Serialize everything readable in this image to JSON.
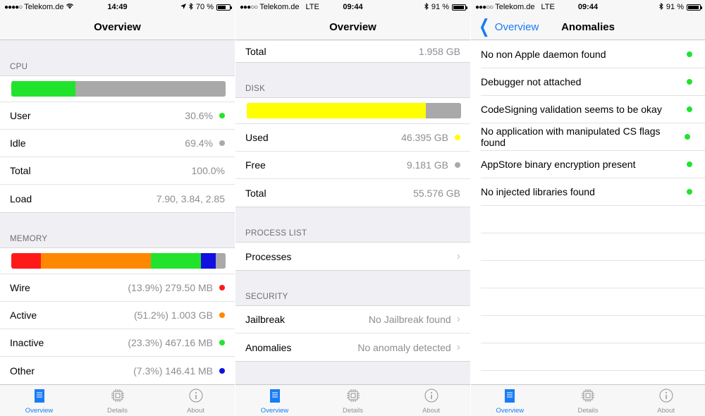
{
  "colors": {
    "green": "#22e32c",
    "gray": "#a9a9a9",
    "red": "#ff1a1a",
    "orange": "#ff8800",
    "blue": "#1010e0",
    "yellow": "#ffff00",
    "accent": "#1a7cf5"
  },
  "screen1": {
    "status": {
      "carrier": "Telekom.de",
      "time": "14:49",
      "battery_pct": "70 %",
      "battery_level": 0.7
    },
    "title": "Overview",
    "cpu": {
      "header": "CPU",
      "bar": [
        0.3,
        0.7
      ],
      "rows": [
        {
          "label": "User",
          "value": "30.6%",
          "dot": "#22e32c"
        },
        {
          "label": "Idle",
          "value": "69.4%",
          "dot": "#a9a9a9"
        },
        {
          "label": "Total",
          "value": "100.0%"
        },
        {
          "label": "Load",
          "value": "7.90, 3.84, 2.85"
        }
      ]
    },
    "memory": {
      "header": "MEMORY",
      "bar": [
        0.139,
        0.512,
        0.233,
        0.07,
        0.046
      ],
      "rows": [
        {
          "label": "Wire",
          "value": "(13.9%) 279.50 MB",
          "dot": "#ff1a1a"
        },
        {
          "label": "Active",
          "value": "(51.2%) 1.003 GB",
          "dot": "#ff8800"
        },
        {
          "label": "Inactive",
          "value": "(23.3%) 467.16 MB",
          "dot": "#22e32c"
        },
        {
          "label": "Other",
          "value": "(7.3%) 146.41 MB",
          "dot": "#1010e0"
        }
      ]
    }
  },
  "screen2": {
    "status": {
      "carrier": "Telekom.de",
      "network": "LTE",
      "time": "09:44",
      "battery_pct": "91 %",
      "battery_level": 0.91
    },
    "title": "Overview",
    "memory_total": {
      "label": "Total",
      "value": "1.958 GB"
    },
    "disk": {
      "header": "DISK",
      "bar": [
        0.835,
        0.165
      ],
      "rows": [
        {
          "label": "Used",
          "value": "46.395 GB",
          "dot": "#ffff00"
        },
        {
          "label": "Free",
          "value": "9.181 GB",
          "dot": "#a9a9a9"
        },
        {
          "label": "Total",
          "value": "55.576 GB"
        }
      ]
    },
    "process": {
      "header": "PROCESS LIST",
      "row": {
        "label": "Processes"
      }
    },
    "security": {
      "header": "SECURITY",
      "rows": [
        {
          "label": "Jailbreak",
          "value": "No Jailbreak found"
        },
        {
          "label": "Anomalies",
          "value": "No anomaly detected"
        }
      ]
    }
  },
  "screen3": {
    "status": {
      "carrier": "Telekom.de",
      "network": "LTE",
      "time": "09:44",
      "battery_pct": "91 %",
      "battery_level": 0.91
    },
    "back_label": "Overview",
    "title": "Anomalies",
    "items": [
      "No non Apple daemon found",
      "Debugger not attached",
      "CodeSigning validation seems to be okay",
      "No application with manipulated CS flags found",
      "AppStore binary encryption present",
      "No injected libraries found"
    ]
  },
  "tabs": [
    {
      "label": "Overview",
      "icon": "document-icon"
    },
    {
      "label": "Details",
      "icon": "chip-icon"
    },
    {
      "label": "About",
      "icon": "info-icon"
    }
  ]
}
